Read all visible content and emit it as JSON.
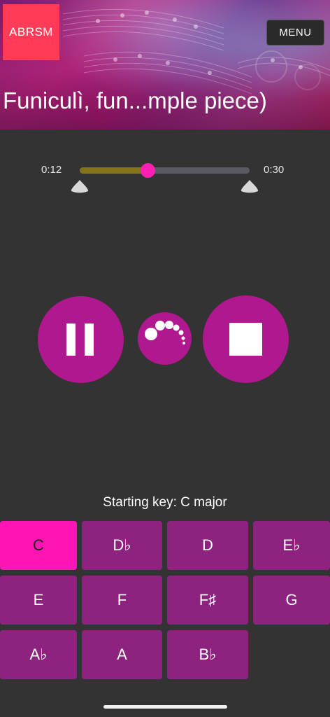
{
  "header": {
    "logo": "ABRSM",
    "menu_label": "MENU",
    "title": "Funiculì, fun...mple piece)"
  },
  "player": {
    "elapsed": "0:12",
    "duration": "0:30",
    "progress_fraction": 0.4,
    "controls": {
      "pause_icon": "pause-icon",
      "metronome_icon": "metronome-icon",
      "stop_icon": "stop-icon"
    }
  },
  "keys": {
    "starting_key_label": "Starting key: C major",
    "selected": "C",
    "items": [
      "C",
      "D♭",
      "D",
      "E♭",
      "E",
      "F",
      "F♯",
      "G",
      "A♭",
      "A",
      "B♭"
    ]
  },
  "colors": {
    "accent": "#b0188f",
    "key_button": "#8d237f",
    "key_selected": "#ff14b4",
    "logo": "#ff3b57",
    "progress_fill": "#857417",
    "thumb": "#ff1fb0"
  }
}
